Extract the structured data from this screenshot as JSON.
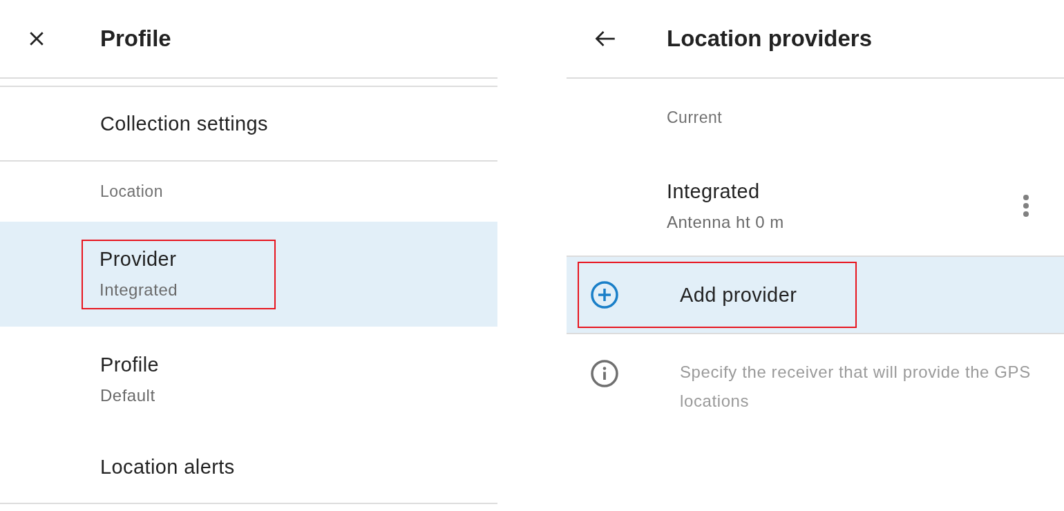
{
  "left_panel": {
    "title": "Profile",
    "items": [
      {
        "kind": "item",
        "label": "Collection settings",
        "selected": false,
        "highlighted": false
      },
      {
        "kind": "section",
        "label": "Location"
      },
      {
        "kind": "item",
        "label": "Provider",
        "subtitle": "Integrated",
        "selected": true,
        "highlighted": true
      },
      {
        "kind": "item",
        "label": "Profile",
        "subtitle": "Default",
        "selected": false,
        "highlighted": false
      },
      {
        "kind": "item",
        "label": "Location alerts",
        "selected": false,
        "highlighted": false
      }
    ]
  },
  "right_panel": {
    "title": "Location providers",
    "items": [
      {
        "kind": "section",
        "label": "Current"
      },
      {
        "kind": "provider",
        "label": "Integrated",
        "subtitle": "Antenna ht 0 m",
        "selected": false,
        "highlighted": false
      },
      {
        "kind": "action",
        "label": "Add provider",
        "selected": true,
        "highlighted": true
      },
      {
        "kind": "note",
        "label": "Specify the receiver that will provide the GPS locations"
      }
    ]
  }
}
